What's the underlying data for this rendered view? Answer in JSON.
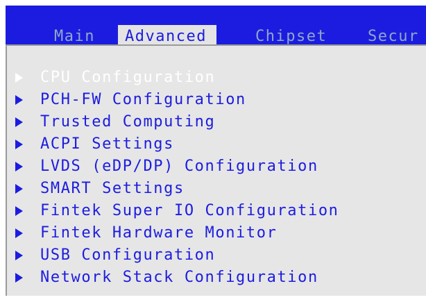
{
  "tabs": [
    {
      "label": "Main"
    },
    {
      "label": "Advanced",
      "active": true
    },
    {
      "label": "Chipset"
    },
    {
      "label": "Secur"
    }
  ],
  "menu": [
    {
      "label": "CPU Configuration",
      "selected": true
    },
    {
      "label": "PCH-FW Configuration"
    },
    {
      "label": "Trusted Computing"
    },
    {
      "label": "ACPI Settings"
    },
    {
      "label": "LVDS (eDP/DP) Configuration"
    },
    {
      "label": "SMART Settings"
    },
    {
      "label": "Fintek Super IO Configuration"
    },
    {
      "label": "Fintek Hardware Monitor"
    },
    {
      "label": "USB Configuration"
    },
    {
      "label": "Network Stack Configuration"
    }
  ],
  "colors": {
    "header_bg": "#1c1ce0",
    "panel_bg": "#e6e6e6",
    "menu_text": "#1c1ce0",
    "selected_text": "#ffffff",
    "inactive_tab_text": "#8ea8c8"
  }
}
